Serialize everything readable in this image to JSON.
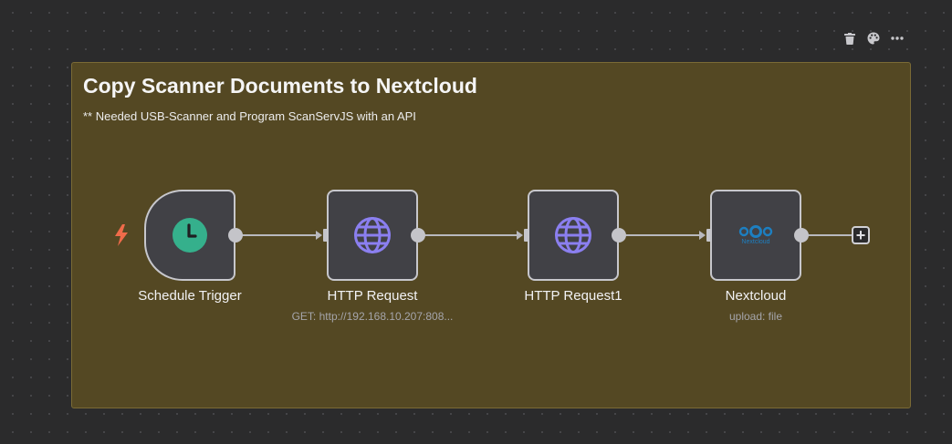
{
  "toolbar": {
    "items": [
      {
        "icon": "trash-icon"
      },
      {
        "icon": "palette-icon"
      },
      {
        "icon": "more-horizontal-icon"
      }
    ]
  },
  "sticky_note": {
    "title": "Copy Scanner Documents to Nextcloud",
    "content": "** Needed USB-Scanner and Program ScanServJS with an API",
    "color": "#544823"
  },
  "nodes": [
    {
      "name": "Schedule Trigger",
      "subtitle": "",
      "icon": "clock-icon",
      "icon_color": "#35b08c"
    },
    {
      "name": "HTTP Request",
      "subtitle": "GET: http://192.168.10.207:808...",
      "icon": "globe-icon",
      "icon_color": "#8b7ff0"
    },
    {
      "name": "HTTP Request1",
      "subtitle": "",
      "icon": "globe-icon",
      "icon_color": "#8b7ff0"
    },
    {
      "name": "Nextcloud",
      "subtitle": "upload: file",
      "icon": "nextcloud-icon",
      "icon_color": "#1d7fc1"
    }
  ],
  "nextcloud_logo_text": "Nextcloud",
  "trigger_indicator": {
    "icon": "lightning-icon",
    "color": "#ef6b4a"
  },
  "add_node": {
    "icon": "plus-icon"
  }
}
